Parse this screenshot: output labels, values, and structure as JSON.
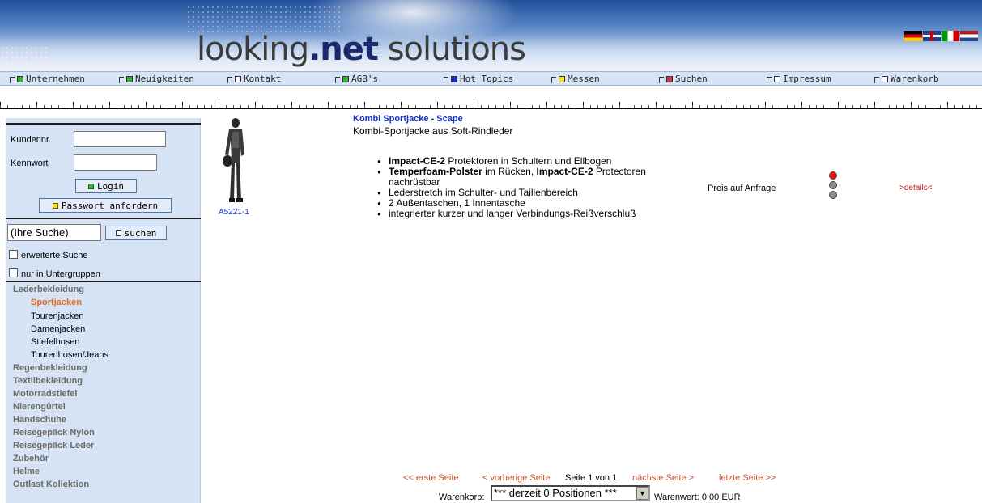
{
  "header": {
    "logo_main": "looking",
    "logo_dot_net": ".net",
    "logo_tail": "solutions",
    "languages": [
      "de",
      "en",
      "it",
      "nl"
    ]
  },
  "nav": {
    "items": [
      {
        "label": "Unternehmen",
        "marker_color": "#2db52d"
      },
      {
        "label": "Neuigkeiten",
        "marker_color": "#2db52d"
      },
      {
        "label": "Kontakt",
        "marker_color": "#ffffff"
      },
      {
        "label": "AGB's",
        "marker_color": "#2db52d"
      },
      {
        "label": "Hot Topics",
        "marker_color": "#1a2ad0"
      },
      {
        "label": "Messen",
        "marker_color": "#ffe000"
      },
      {
        "label": "Suchen",
        "marker_color": "#d0304a"
      },
      {
        "label": "Impressum",
        "marker_color": "#ffffff"
      },
      {
        "label": "Warenkorb",
        "marker_color": "#ffffff"
      }
    ]
  },
  "login": {
    "customer_label": "Kundennr.",
    "password_label": "Kennwort",
    "login_button": "Login",
    "request_password_button": "Passwort anfordern"
  },
  "search": {
    "value": "(Ihre Suche)",
    "button": "suchen",
    "extended_label": "erweiterte Suche",
    "subgroups_label": "nur in Untergruppen"
  },
  "categories": {
    "lederbekleidung": "Lederbekleidung",
    "sub": [
      "Sportjacken",
      "Tourenjacken",
      "Damenjacken",
      "Stiefelhosen",
      "Tourenhosen/Jeans"
    ],
    "rest": [
      "Regenbekleidung",
      "Textilbekleidung",
      "Motorradstiefel",
      "Nierengürtel",
      "Handschuhe",
      "Reisegepäck Nylon",
      "Reisegepäck Leder",
      "Zubehör",
      "Helme",
      "Outlast Kollektion"
    ]
  },
  "product": {
    "article_no": "A5221-1",
    "title": "Kombi Sportjacke - Scape",
    "subtitle": "Kombi-Sportjacke aus Soft-Rindleder",
    "f1_bold": "Impact-CE-2",
    "f1_rest": " Protektoren in Schultern und Ellbogen",
    "f2_bold1": "Temperfoam-Polster",
    "f2_mid": " im Rücken, ",
    "f2_bold2": "Impact-CE-2",
    "f2_rest": " Protectoren nachrüstbar",
    "f3": "Lederstretch im Schulter- und Taillenbereich",
    "f4": "2 Außentaschen, 1 Innentasche",
    "f5": "integrierter kurzer und langer Verbindungs-Reißverschluß",
    "price": "Preis auf Anfrage",
    "availability": "red",
    "details_link": ">details<"
  },
  "pagination": {
    "first": "<< erste Seite",
    "prev": "< vorherige Seite",
    "current": "Seite 1 von 1",
    "next": "nächste Seite >",
    "last": "letzte Seite >>"
  },
  "cart": {
    "label": "Warenkorb:",
    "selected": "*** derzeit 0 Positionen ***",
    "value_text": "Warenwert: 0,00 EUR"
  }
}
